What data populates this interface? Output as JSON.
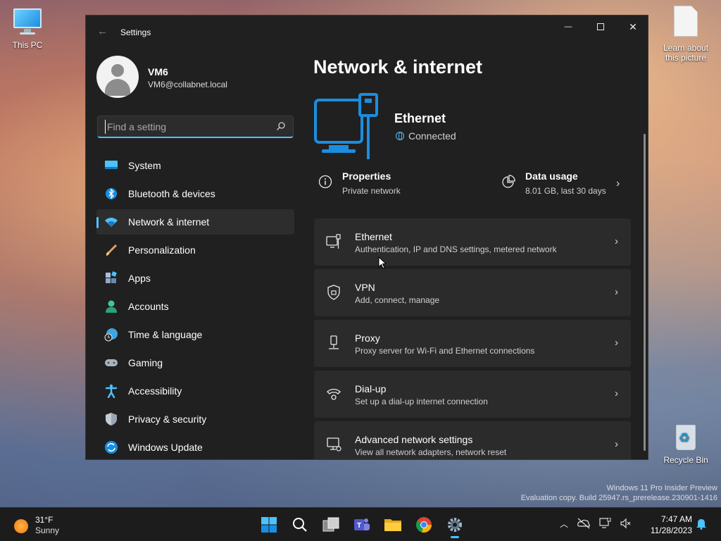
{
  "desktop": {
    "icons": [
      {
        "label": "This PC"
      },
      {
        "label": "Learn about this picture"
      },
      {
        "label": "Recycle Bin"
      }
    ],
    "watermark": {
      "line1": "Windows 11 Pro Insider Preview",
      "line2": "Evaluation copy. Build 25947.rs_prerelease.230901-1416"
    }
  },
  "window": {
    "title": "Settings",
    "controls": {
      "minimize": "—",
      "close": "✕"
    }
  },
  "profile": {
    "name": "VM6",
    "email": "VM6@collabnet.local"
  },
  "search": {
    "placeholder": "Find a setting"
  },
  "sidebar": {
    "items": [
      {
        "label": "System",
        "icon": "system-icon"
      },
      {
        "label": "Bluetooth & devices",
        "icon": "bluetooth-icon"
      },
      {
        "label": "Network & internet",
        "icon": "wifi-icon",
        "active": true
      },
      {
        "label": "Personalization",
        "icon": "brush-icon"
      },
      {
        "label": "Apps",
        "icon": "apps-icon"
      },
      {
        "label": "Accounts",
        "icon": "accounts-icon"
      },
      {
        "label": "Time & language",
        "icon": "globe-clock-icon"
      },
      {
        "label": "Gaming",
        "icon": "gamepad-icon"
      },
      {
        "label": "Accessibility",
        "icon": "accessibility-icon"
      },
      {
        "label": "Privacy & security",
        "icon": "shield-icon"
      },
      {
        "label": "Windows Update",
        "icon": "update-icon"
      }
    ]
  },
  "main": {
    "title": "Network & internet",
    "connection": {
      "name": "Ethernet",
      "status": "Connected"
    },
    "properties": {
      "title": "Properties",
      "subtitle": "Private network"
    },
    "data_usage": {
      "title": "Data usage",
      "subtitle": "8.01 GB, last 30 days"
    },
    "cards": [
      {
        "title": "Ethernet",
        "subtitle": "Authentication, IP and DNS settings, metered network",
        "icon": "ethernet-icon"
      },
      {
        "title": "VPN",
        "subtitle": "Add, connect, manage",
        "icon": "vpn-shield-icon"
      },
      {
        "title": "Proxy",
        "subtitle": "Proxy server for Wi-Fi and Ethernet connections",
        "icon": "proxy-icon"
      },
      {
        "title": "Dial-up",
        "subtitle": "Set up a dial-up internet connection",
        "icon": "dialup-icon"
      },
      {
        "title": "Advanced network settings",
        "subtitle": "View all network adapters, network reset",
        "icon": "advanced-network-icon"
      }
    ]
  },
  "taskbar": {
    "weather": {
      "temp": "31°F",
      "condition": "Sunny"
    },
    "clock": {
      "time": "7:47 AM",
      "date": "11/28/2023"
    },
    "accent": "#4cc2ff"
  }
}
